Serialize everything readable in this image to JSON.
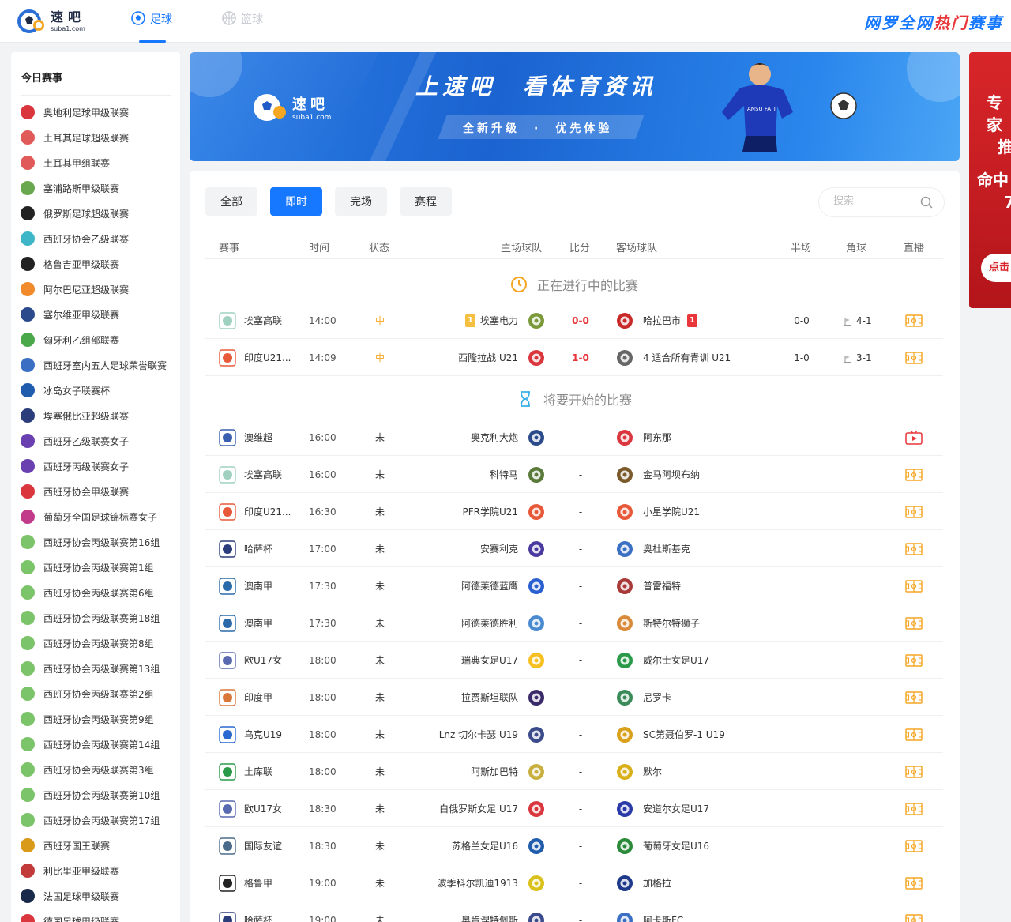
{
  "header": {
    "logo_name": "速吧",
    "logo_domain": "suba1.com",
    "nav": [
      {
        "label": "足球",
        "active": true
      },
      {
        "label": "篮球",
        "active": false
      }
    ],
    "slogan_pre": "网罗全网",
    "slogan_hot": "热门",
    "slogan_post": "赛事"
  },
  "sidebar": {
    "title": "今日赛事",
    "items": [
      {
        "label": "奥地利足球甲级联赛",
        "color": "#d9363e"
      },
      {
        "label": "土耳其足球超级联赛",
        "color": "#e05a5a"
      },
      {
        "label": "土耳其甲组联赛",
        "color": "#e05a5a"
      },
      {
        "label": "塞浦路斯甲级联赛",
        "color": "#6aa84f"
      },
      {
        "label": "俄罗斯足球超级联赛",
        "color": "#222222"
      },
      {
        "label": "西班牙协会乙级联赛",
        "color": "#3fb6c8"
      },
      {
        "label": "格鲁吉亚甲级联赛",
        "color": "#222222"
      },
      {
        "label": "阿尔巴尼亚超级联赛",
        "color": "#f08a2a"
      },
      {
        "label": "塞尔维亚甲级联赛",
        "color": "#2b4a8b"
      },
      {
        "label": "匈牙利乙组部联赛",
        "color": "#4aa84a"
      },
      {
        "label": "西班牙室内五人足球荣誉联赛",
        "color": "#3b6fc4"
      },
      {
        "label": "冰岛女子联赛杯",
        "color": "#1f5cad"
      },
      {
        "label": "埃塞俄比亚超级联赛",
        "color": "#2b3d7a"
      },
      {
        "label": "西班牙乙级联赛女子",
        "color": "#6a3fb0"
      },
      {
        "label": "西班牙丙级联赛女子",
        "color": "#6a3fb0"
      },
      {
        "label": "西班牙协会甲级联赛",
        "color": "#d9363e"
      },
      {
        "label": "葡萄牙全国足球锦标赛女子",
        "color": "#c23a8a"
      },
      {
        "label": "西班牙协会丙级联赛第16组",
        "color": "#7cc46a"
      },
      {
        "label": "西班牙协会丙级联赛第1组",
        "color": "#7cc46a"
      },
      {
        "label": "西班牙协会丙级联赛第6组",
        "color": "#7cc46a"
      },
      {
        "label": "西班牙协会丙级联赛第18组",
        "color": "#7cc46a"
      },
      {
        "label": "西班牙协会丙级联赛第8组",
        "color": "#7cc46a"
      },
      {
        "label": "西班牙协会丙级联赛第13组",
        "color": "#7cc46a"
      },
      {
        "label": "西班牙协会丙级联赛第2组",
        "color": "#7cc46a"
      },
      {
        "label": "西班牙协会丙级联赛第9组",
        "color": "#7cc46a"
      },
      {
        "label": "西班牙协会丙级联赛第14组",
        "color": "#7cc46a"
      },
      {
        "label": "西班牙协会丙级联赛第3组",
        "color": "#7cc46a"
      },
      {
        "label": "西班牙协会丙级联赛第10组",
        "color": "#7cc46a"
      },
      {
        "label": "西班牙协会丙级联赛第17组",
        "color": "#7cc46a"
      },
      {
        "label": "西班牙国王联赛",
        "color": "#d99a1a"
      },
      {
        "label": "利比里亚甲级联赛",
        "color": "#c23a3a"
      },
      {
        "label": "法国足球甲级联赛",
        "color": "#1a2a4a"
      },
      {
        "label": "德国足球甲级联赛",
        "color": "#d9363e"
      }
    ]
  },
  "banner": {
    "logo_name": "速吧",
    "logo_domain": "suba1.com",
    "headline": "上速吧　看体育资讯",
    "sub": "全新升级　·　优先体验",
    "jersey_text": "ANSU FATI"
  },
  "promo": {
    "line1": "专家",
    "line1b": "推",
    "line2": "命中",
    "line2b": "7",
    "button": "点击"
  },
  "filters": {
    "tabs": [
      {
        "label": "全部",
        "active": false
      },
      {
        "label": "即时",
        "active": true
      },
      {
        "label": "完场",
        "active": false
      },
      {
        "label": "赛程",
        "active": false
      }
    ],
    "search_placeholder": "搜索"
  },
  "table": {
    "headers": {
      "league": "赛事",
      "time": "时间",
      "status": "状态",
      "home": "主场球队",
      "score": "比分",
      "away": "客场球队",
      "half": "半场",
      "corner": "角球",
      "live": "直播"
    },
    "section_live": "正在进行中的比赛",
    "section_upcoming": "将要开始的比赛",
    "live_matches": [
      {
        "league": "埃塞高联",
        "lc": "#9fd0c0",
        "time": "14:00",
        "status": "中",
        "home": "埃塞电力",
        "home_card": "1",
        "home_card_color": "#f5c040",
        "hc": "#7a9a3a",
        "score": "0-0",
        "away": "哈拉巴市",
        "away_card": "1",
        "away_card_color": "#e8363a",
        "ac": "#c82a2a",
        "half": "0-0",
        "corner": "4-1"
      },
      {
        "league": "印度U21...",
        "lc": "#e8593a",
        "time": "14:09",
        "status": "中",
        "home": "西隆拉战 U21",
        "home_card": "",
        "home_card_color": "",
        "hc": "#d9363e",
        "score": "1-0",
        "away": "4 适合所有青训 U21",
        "away_card": "",
        "away_card_color": "",
        "ac": "#666666",
        "half": "1-0",
        "corner": "3-1"
      }
    ],
    "upcoming_matches": [
      {
        "league": "澳维超",
        "lc": "#3a5fb0",
        "time": "16:00",
        "status": "未",
        "home": "奥克利大炮",
        "hc": "#2b4a8b",
        "score": "-",
        "away": "阿东那",
        "ac": "#d9363e",
        "live_type": "tv"
      },
      {
        "league": "埃塞高联",
        "lc": "#9fd0c0",
        "time": "16:00",
        "status": "未",
        "home": "科特马",
        "hc": "#5a7a3a",
        "score": "-",
        "away": "金马阿坝布纳",
        "ac": "#7a5a2a",
        "live_type": "field"
      },
      {
        "league": "印度U21...",
        "lc": "#e8593a",
        "time": "16:30",
        "status": "未",
        "home": "PFR学院U21",
        "hc": "#e8593a",
        "score": "-",
        "away": "小星学院U21",
        "ac": "#e8593a",
        "live_type": "field"
      },
      {
        "league": "哈萨杯",
        "lc": "#2b3d7a",
        "time": "17:00",
        "status": "未",
        "home": "安赛利克",
        "hc": "#4a3aa0",
        "score": "-",
        "away": "奥杜斯基克",
        "ac": "#3a6fc4",
        "live_type": "field"
      },
      {
        "league": "澳南甲",
        "lc": "#2a6aa8",
        "time": "17:30",
        "status": "未",
        "home": "阿德莱德蓝鹰",
        "hc": "#2a5fd0",
        "score": "-",
        "away": "普雷福特",
        "ac": "#a83a3a",
        "live_type": "field"
      },
      {
        "league": "澳南甲",
        "lc": "#2a6aa8",
        "time": "17:30",
        "status": "未",
        "home": "阿德莱德胜利",
        "hc": "#4a8ad0",
        "score": "-",
        "away": "斯特尔特狮子",
        "ac": "#d98a3a",
        "live_type": "field"
      },
      {
        "league": "欧U17女",
        "lc": "#5a6ab0",
        "time": "18:00",
        "status": "未",
        "home": "瑞典女足U17",
        "hc": "#f5c020",
        "score": "-",
        "away": "威尔士女足U17",
        "ac": "#2a9a4a",
        "live_type": "field"
      },
      {
        "league": "印度甲",
        "lc": "#d9783a",
        "time": "18:00",
        "status": "未",
        "home": "拉贾斯坦联队",
        "hc": "#3a2a6a",
        "score": "-",
        "away": "尼罗卡",
        "ac": "#3a8a5a",
        "live_type": "field"
      },
      {
        "league": "乌克U19",
        "lc": "#2a6ad0",
        "time": "18:00",
        "status": "未",
        "home": "Lnz 切尔卡瑟 U19",
        "hc": "#3a4a8a",
        "score": "-",
        "away": "SC第聂伯罗-1 U19",
        "ac": "#d9a01a",
        "live_type": "field"
      },
      {
        "league": "土库联",
        "lc": "#2a9a4a",
        "time": "18:00",
        "status": "未",
        "home": "阿斯加巴特",
        "hc": "#c8b040",
        "score": "-",
        "away": "默尔",
        "ac": "#d9b01a",
        "live_type": "field"
      },
      {
        "league": "欧U17女",
        "lc": "#5a6ab0",
        "time": "18:30",
        "status": "未",
        "home": "白俄罗斯女足 U17",
        "hc": "#d9363e",
        "score": "-",
        "away": "安道尔女足U17",
        "ac": "#2a3aa8",
        "live_type": "field"
      },
      {
        "league": "国际友谊",
        "lc": "#4a6a8a",
        "time": "18:30",
        "status": "未",
        "home": "苏格兰女足U16",
        "hc": "#1f5cad",
        "score": "-",
        "away": "葡萄牙女足U16",
        "ac": "#2a8a3a",
        "live_type": "field"
      },
      {
        "league": "格鲁甲",
        "lc": "#222222",
        "time": "19:00",
        "status": "未",
        "home": "波季科尔凯迪1913",
        "hc": "#d9c01a",
        "score": "-",
        "away": "加格拉",
        "ac": "#1f3a8a",
        "live_type": "field"
      },
      {
        "league": "哈萨杯",
        "lc": "#2b3d7a",
        "time": "19:00",
        "status": "未",
        "home": "奥肯涅特佩斯",
        "hc": "#3a4a8a",
        "score": "-",
        "away": "阿卡斯FC",
        "ac": "#3a6fc4",
        "live_type": "field"
      }
    ]
  }
}
